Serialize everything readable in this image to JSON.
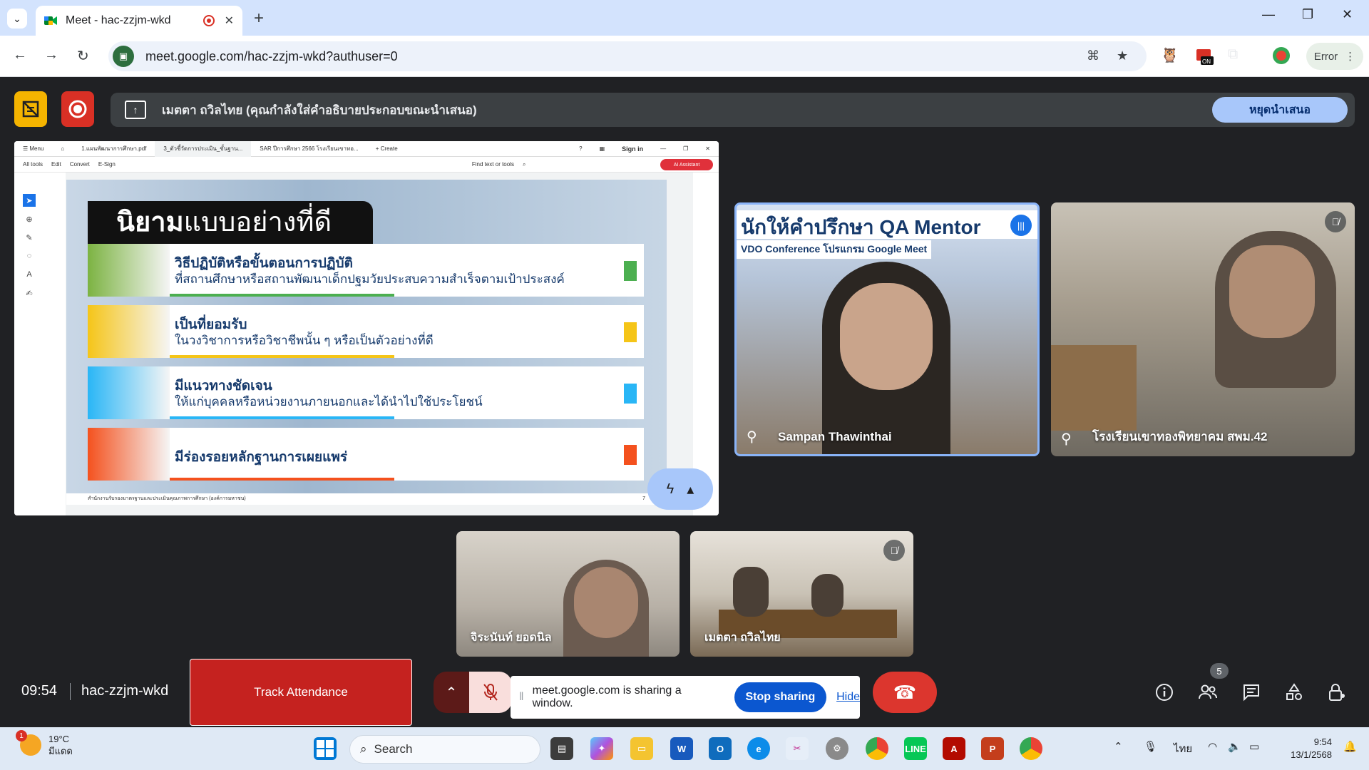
{
  "browser": {
    "tab_title": "Meet - hac-zzjm-wkd",
    "url": "meet.google.com/hac-zzjm-wkd?authuser=0",
    "error_label": "Error"
  },
  "presenting": {
    "message": "เมตตา ถวิลไทย (คุณกำลังใส่คำอธิบายประกอบขณะนำเสนอ)",
    "stop_label": "หยุดนำเสนอ"
  },
  "pdf": {
    "tabs": [
      "1.แผนพัฒนาการศึกษา.pdf",
      "3_ตัวชี้วัดการประเมิน_ขั้นฐาน...",
      "SAR ปีการศึกษา 2566 โรงเรียนเขาทอ...",
      "+ Create"
    ],
    "signin": "Sign in",
    "menu": [
      "All tools",
      "Edit",
      "Convert",
      "E-Sign"
    ],
    "find": "Find text or tools",
    "ai": "AI Assistant",
    "footer": "สำนักงานรับรองมาตรฐานและประเมินคุณภาพการศึกษา (องค์การมหาชน)",
    "page": "7"
  },
  "slide": {
    "title_bold": "นิยาม",
    "title_rest": "แบบอย่างที่ดี",
    "rows": [
      {
        "heading": "วิธีปฏิบัติหรือขั้นตอนการปฏิบัติ",
        "sub": "ที่สถานศึกษาหรือสถานพัฒนาเด็กปฐมวัยประสบความสำเร็จตามเป้าประสงค์",
        "color": "#4caf50"
      },
      {
        "heading": "เป็นที่ยอมรับ",
        "sub": "ในวงวิชาการหรือวิชาชีพนั้น ๆ หรือเป็นตัวอย่างที่ดี",
        "color": "#f5c518"
      },
      {
        "heading": "มีแนวทางชัดเจน",
        "sub": "ให้แก่บุคคลหรือหน่วยงานภายนอกและได้นำไปใช้ประโยชน์",
        "color": "#29b6f6"
      },
      {
        "heading": "มีร่องรอยหลักฐานการเผยแพร่",
        "sub": "",
        "color": "#f4511e"
      }
    ]
  },
  "participants": {
    "p1": {
      "name": "Sampan Thawinthai",
      "banner": "นักให้คำปรึกษา QA Mentor",
      "banner_sub": "VDO Conference โปรแกรม Google Meet"
    },
    "p2": {
      "name": "โรงเรียนเขาทองพิทยาคม สพม.42"
    },
    "p3": {
      "name": "จิระนันท์ ยอดนิล"
    },
    "p4": {
      "name": "เมตตา ถวิลไทย"
    }
  },
  "bottom": {
    "time": "09:54",
    "meeting_code": "hac-zzjm-wkd",
    "track_label": "Track Attendance",
    "sharing_msg": "meet.google.com is sharing a window.",
    "stop_sharing": "Stop sharing",
    "hide": "Hide",
    "people_count": "5"
  },
  "taskbar": {
    "temp": "19°C",
    "weather": "มีแดด",
    "weather_badge": "1",
    "search": "Search",
    "lang": "ไทย",
    "time": "9:54",
    "date": "13/1/2568"
  },
  "colors": {
    "accent": "#a8c7fa",
    "end_call": "#dc362e",
    "track": "#c5221f"
  }
}
